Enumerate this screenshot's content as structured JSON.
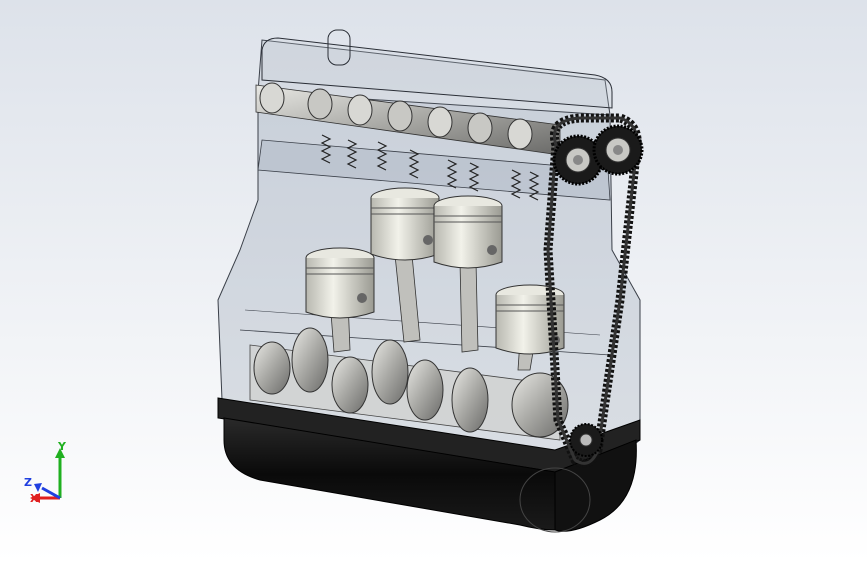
{
  "viewport": {
    "background_top": "#dde2ea",
    "background_bottom": "#ffffff"
  },
  "triad": {
    "x_label": "X",
    "y_label": "Y",
    "z_label": "Z",
    "x_color": "#e02020",
    "y_color": "#20b020",
    "z_color": "#2040e0"
  }
}
